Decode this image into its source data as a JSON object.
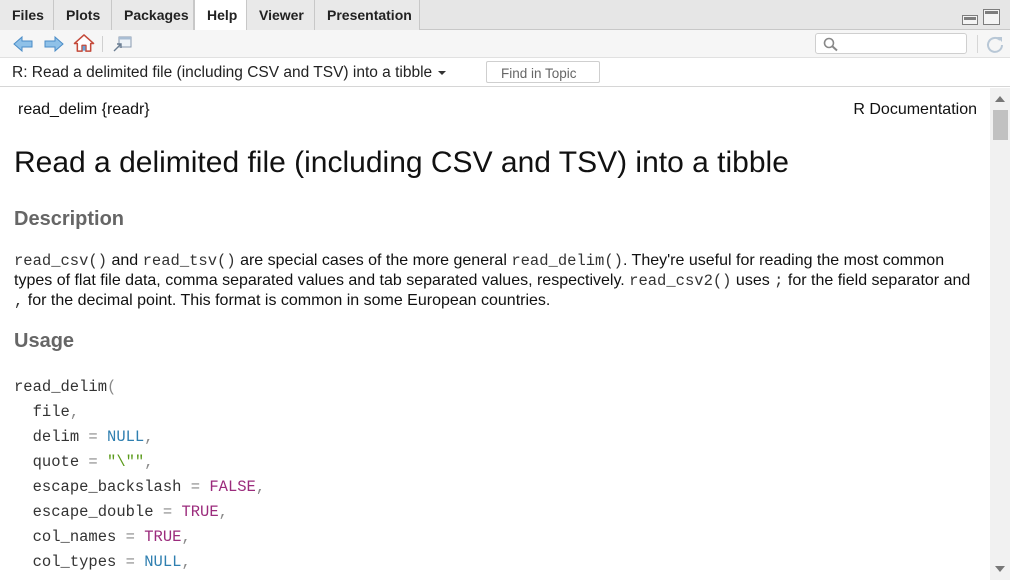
{
  "tabs": [
    {
      "label": "Files",
      "active": false
    },
    {
      "label": "Plots",
      "active": false
    },
    {
      "label": "Packages",
      "active": false
    },
    {
      "label": "Help",
      "active": true
    },
    {
      "label": "Viewer",
      "active": false
    },
    {
      "label": "Presentation",
      "active": false
    }
  ],
  "toolbar": {
    "icons": [
      "back-arrow-icon",
      "forward-arrow-icon",
      "home-icon",
      "show-in-window-icon",
      "refresh-icon"
    ],
    "search_placeholder": ""
  },
  "topic": {
    "title": "R: Read a delimited file (including CSV and TSV) into a tibble",
    "find_placeholder": "Find in Topic"
  },
  "doc": {
    "header_left": "read_delim {readr}",
    "header_right": "R Documentation",
    "title": "Read a delimited file (including CSV and TSV) into a tibble",
    "description_heading": "Description",
    "desc": {
      "c1": "read_csv()",
      "t1": " and ",
      "c2": "read_tsv()",
      "t2": " are special cases of the more general ",
      "c3": "read_delim()",
      "t3": ". They're useful for reading the most common types of flat file data, comma separated values and tab separated values, respectively. ",
      "c4": "read_csv2()",
      "t4": " uses ",
      "c5": ";",
      "t5": " for the field separator and ",
      "c6": ",",
      "t6": " for the decimal point. This format is common in some European countries."
    },
    "usage_heading": "Usage",
    "usage": {
      "fn": "read_delim",
      "open": "(",
      "file": "file",
      "delim": "delim",
      "delim_val": "NULL",
      "quote": "quote",
      "quote_val": "\"\\\"\"",
      "escape_backslash": "escape_backslash",
      "escape_backslash_val": "FALSE",
      "escape_double": "escape_double",
      "escape_double_val": "TRUE",
      "col_names": "col_names",
      "col_names_val": "TRUE",
      "col_types": "col_types",
      "col_types_val": "NULL",
      "eq": " = ",
      "comma": ","
    }
  },
  "colors": {
    "keyword_blue": "#2f7fb0",
    "keyword_purple": "#9b2b7c",
    "string_green": "#5a9a1a",
    "section_heading": "#666666"
  }
}
